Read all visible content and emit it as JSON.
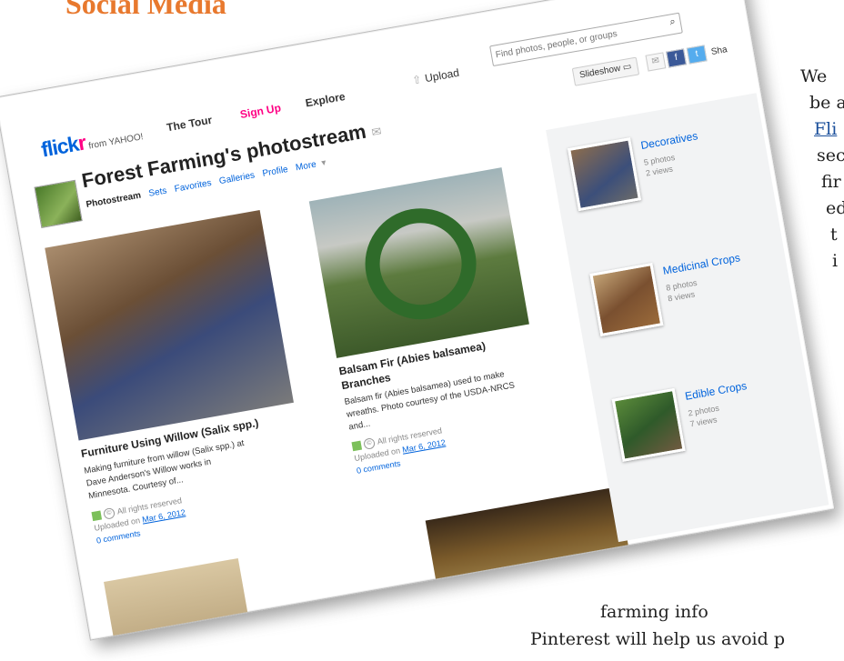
{
  "page": {
    "heading": "Social Media",
    "text_lines": [
      "We",
      "be a",
      "Fli",
      "sec",
      "fir",
      "ed",
      "t",
      "i"
    ],
    "link_text": "Fli",
    "bottom_lines": [
      "farming info",
      "Pinterest will help us avoid p"
    ]
  },
  "flickr": {
    "logo_flick": "flick",
    "logo_r": "r",
    "logo_yahoo": "from YAHOO!",
    "nav": [
      "The Tour",
      "Sign Up",
      "Explore"
    ],
    "upload": "Upload",
    "search_placeholder": "Find photos, people, or groups",
    "slideshow": "Slideshow",
    "share": "Sha",
    "title": "Forest Farming's photostream",
    "subnav": [
      "Photostream",
      "Sets",
      "Favorites",
      "Galleries",
      "Profile",
      "More"
    ],
    "photos": [
      {
        "title": "Furniture Using Willow (Salix spp.)",
        "desc": [
          "Making furniture from willow (Salix spp.) at",
          "Dave Anderson's Willow works in",
          "Minnesota. Courtesy of..."
        ],
        "rights": "All rights reserved",
        "uploaded_prefix": "Uploaded on",
        "date": "Mar 6, 2012",
        "comments": "0 comments"
      },
      {
        "title1": "Balsam Fir (Abies balsamea)",
        "title2": "Branches",
        "desc": [
          "Balsam fir (Abies balsamea) used to make",
          "wreaths. Photo courtesy of the USDA-NRCS",
          "and..."
        ],
        "rights": "All rights reserved",
        "uploaded_prefix": "Uploaded on",
        "date": "Mar 6, 2012",
        "comments": "0 comments"
      }
    ],
    "sets": [
      {
        "name": "Decoratives",
        "photos": "5 photos",
        "views": "2 views"
      },
      {
        "name": "Medicinal Crops",
        "photos": "8 photos",
        "views": "8 views"
      },
      {
        "name": "Edible Crops",
        "photos": "2 photos",
        "views": "7 views"
      }
    ]
  }
}
